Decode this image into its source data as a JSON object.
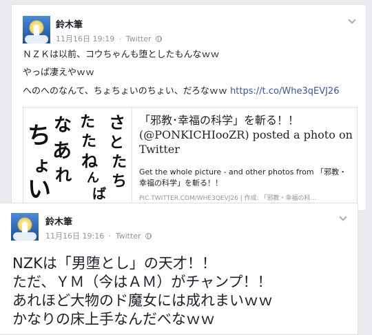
{
  "post1": {
    "author": "鈴木筆",
    "date": "11月16日 19:19",
    "separator": "·",
    "source": "Twitter",
    "lines": [
      "ＮＺＫは以前、コウちゃんも堕としたもんなｗｗ",
      "やっぱ凄えやｗｗ",
      "へのへのなんて、ちょちょいのちょい、だろなｗｗ"
    ],
    "link_text": "https://t.co/Whe3qEVJ26",
    "card": {
      "title": "「邪教･幸福の科学」を斬る！！ (@PONKICHIooZR) posted a photo on Twitter",
      "description": "Get the whole picture - and other photos from 「邪教・幸福の科学」を斬る！！",
      "footer": "PIC.TWITTER.COM/WHE3QEVJ26 | 作成: 「邪教・幸福の科…",
      "image_chars": [
        "ち",
        "ょ",
        "い",
        "な",
        "あ",
        "れ",
        "た",
        "た",
        "ね",
        "ん",
        "ば",
        "さ",
        "と",
        "た",
        "ち"
      ]
    }
  },
  "post2": {
    "author": "鈴木筆",
    "date": "11月16日 19:16",
    "separator": "·",
    "source": "Twitter",
    "lines": [
      "NZKは「男堕とし」の天才！！",
      "ただ、ＹＭ（今はＡＭ）がチャンプ！！",
      "あれほど大物のド魔女には成れまいｗｗ",
      "かなりの床上手なんだべなｗｗ"
    ]
  },
  "colors": {
    "link": "#365899",
    "meta": "#90949c",
    "text": "#1d2129",
    "background": "#e9ebee"
  },
  "icons": [
    "avatar",
    "globe-icon",
    "chevron-down-icon"
  ]
}
